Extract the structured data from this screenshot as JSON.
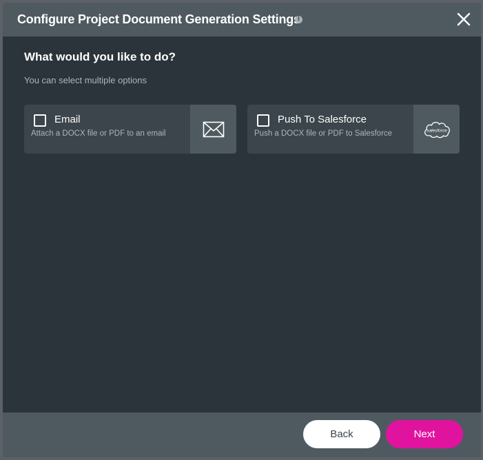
{
  "dialog": {
    "title": "Configure Project Document Generation Settings",
    "info_icon": "info-icon",
    "close_icon": "close-icon"
  },
  "main": {
    "question": "What would you like to do?",
    "hint": "You can select multiple options",
    "options": [
      {
        "label": "Email",
        "description": "Attach a DOCX file or PDF to an email",
        "checked": false,
        "icon": "envelope-icon"
      },
      {
        "label": "Push To Salesforce",
        "description": "Push a DOCX file or PDF to Salesforce",
        "checked": false,
        "icon": "salesforce-cloud-icon",
        "icon_text": "salesforce"
      }
    ]
  },
  "footer": {
    "back_label": "Back",
    "next_label": "Next"
  },
  "colors": {
    "header": "#4f5a60",
    "body": "#2a343a",
    "card": "#3b454b",
    "accent": "#e0139f"
  }
}
